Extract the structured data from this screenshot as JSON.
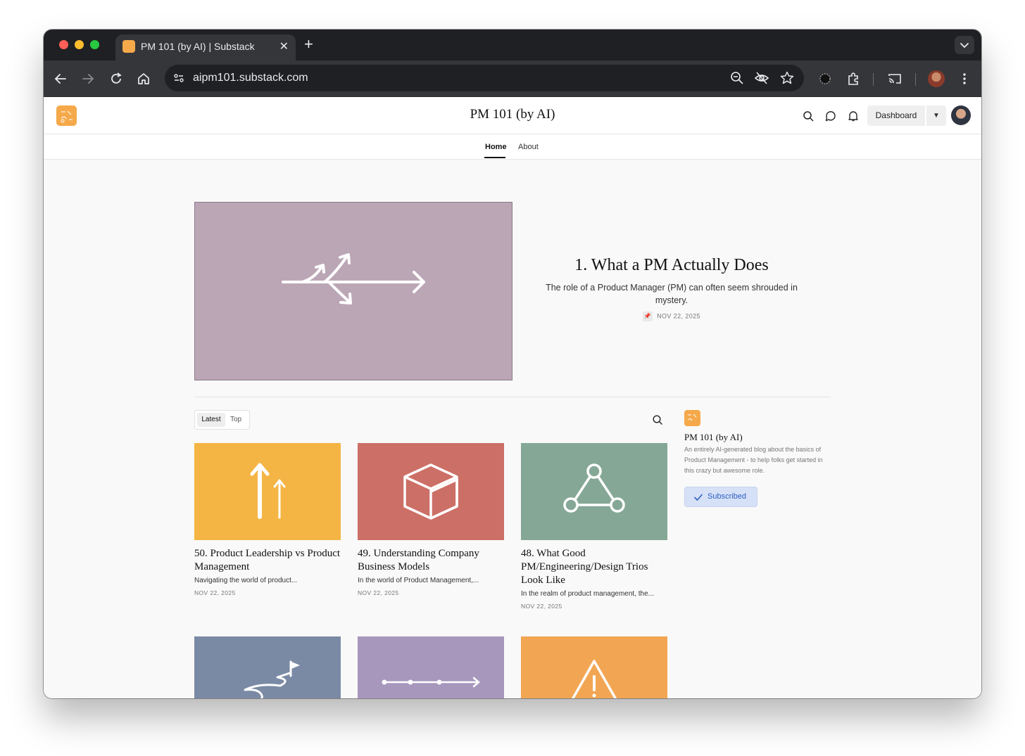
{
  "browser": {
    "tab_title": "PM 101 (by AI) | Substack",
    "tab_close": "✕",
    "new_tab": "+",
    "url": "aipm101.substack.com"
  },
  "publication": {
    "name": "PM 101 (by AI)",
    "dashboard_label": "Dashboard",
    "dropdown_glyph": "▼"
  },
  "nav": {
    "home": "Home",
    "about": "About"
  },
  "hero": {
    "title": "1. What a PM Actually Does",
    "subtitle": "The role of a Product Manager (PM) can often seem shrouded in mystery.",
    "date": "NOV 22, 2025",
    "image_color": "#bba6b6"
  },
  "filters": {
    "latest": "Latest",
    "top": "Top"
  },
  "posts": [
    {
      "title": "50. Product Leadership vs Product Management",
      "subtitle": "Navigating the world of product...",
      "date": "NOV 22, 2025",
      "color": "#f4b544",
      "icon": "arrows-up-icon"
    },
    {
      "title": "49. Understanding Company Business Models",
      "subtitle": "In the world of Product Management,...",
      "date": "NOV 22, 2025",
      "color": "#cc6f66",
      "icon": "cube-icon"
    },
    {
      "title": "48. What Good PM/Engineering/Design Trios Look Like",
      "subtitle": "In the realm of product management, the...",
      "date": "NOV 22, 2025",
      "color": "#85a896",
      "icon": "triangle-nodes-icon"
    },
    {
      "title": "",
      "subtitle": "",
      "date": "",
      "color": "#7a8aa5",
      "icon": "winding-path-flag-icon"
    },
    {
      "title": "",
      "subtitle": "",
      "date": "",
      "color": "#a797bd",
      "icon": "timeline-arrow-icon"
    },
    {
      "title": "",
      "subtitle": "",
      "date": "",
      "color": "#f2a653",
      "icon": "warning-icon"
    }
  ],
  "sidebar": {
    "name": "PM 101 (by AI)",
    "description": "An entirely AI-generated blog about the basics of Product Management - to help folks get started in this crazy but awesome role.",
    "subscribed_label": "Subscribed"
  },
  "colors": {
    "accent_logo": "#f5a94a",
    "subscribed_bg": "#d6e1f7",
    "subscribed_text": "#2d5fc2"
  }
}
